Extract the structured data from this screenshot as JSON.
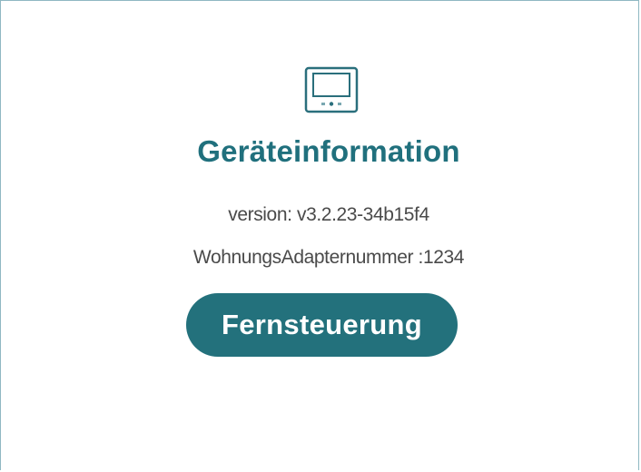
{
  "device_info": {
    "icon": "device-panel-icon",
    "title": "Geräteinformation",
    "version_text": "version: v3.2.23-34b15f4",
    "adapter_text": "WohnungsAdapternummer :1234",
    "remote_button_label": "Fernsteuerung"
  },
  "colors": {
    "accent": "#23717c",
    "title": "#20707d",
    "text": "#4a4a4a",
    "border": "#8fb8c2",
    "background": "#ffffff"
  }
}
